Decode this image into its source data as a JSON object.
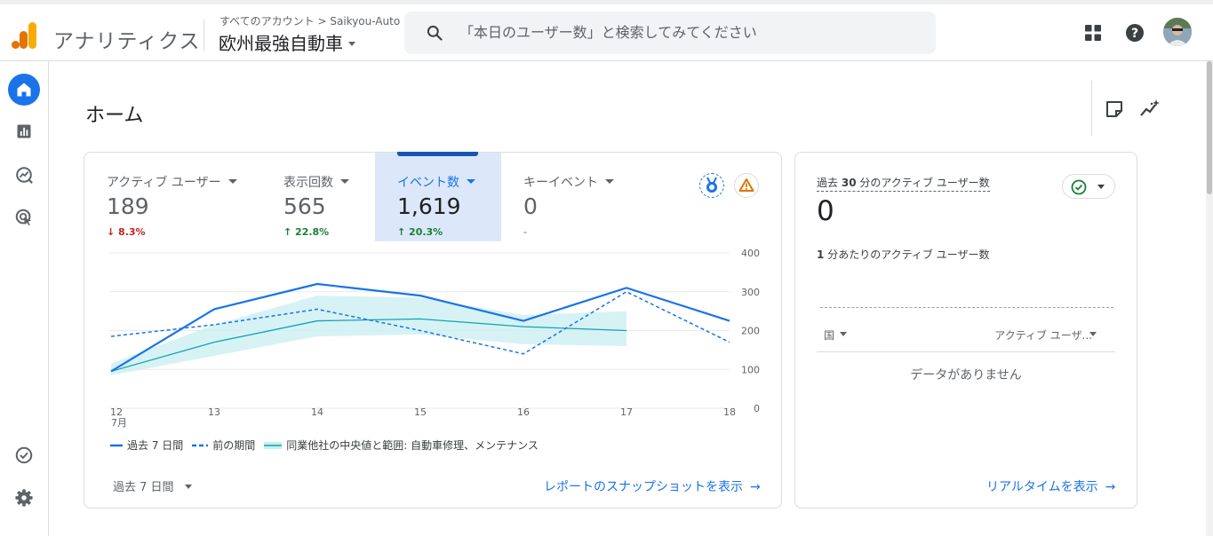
{
  "header": {
    "app_name": "アナリティクス",
    "breadcrumb": "すべてのアカウント > Saikyou-Auto",
    "property_name": "欧州最強自動車",
    "search_placeholder": "「本日のユーザー数」と検索してみてください",
    "icons": [
      "apps-grid-icon",
      "help-icon",
      "account-avatar"
    ]
  },
  "nav": {
    "items": [
      "home-icon",
      "reports-icon",
      "explore-icon",
      "advertising-icon"
    ],
    "bottom_items": [
      "configure-icon",
      "admin-gear-icon"
    ],
    "active": "home-icon"
  },
  "page": {
    "title": "ホーム",
    "header_icons": [
      "notes-icon",
      "insights-icon"
    ]
  },
  "metrics": [
    {
      "label": "アクティブ ユーザー",
      "value": "189",
      "delta": "↓ 8.3%",
      "trend": "down"
    },
    {
      "label": "表示回数",
      "value": "565",
      "delta": "↑ 22.8%",
      "trend": "up"
    },
    {
      "label": "イベント数",
      "value": "1,619",
      "delta": "↑ 20.3%",
      "trend": "up",
      "active": true
    },
    {
      "label": "キーイベント",
      "value": "0",
      "delta": "-",
      "trend": "flat"
    }
  ],
  "chart_data": {
    "type": "line",
    "categories": [
      "12",
      "13",
      "14",
      "15",
      "16",
      "17",
      "18"
    ],
    "x_sublabel": "7月",
    "ylim": [
      0,
      400
    ],
    "yticks": [
      "400",
      "300",
      "200",
      "100",
      "0"
    ],
    "grid": true,
    "series": [
      {
        "name": "過去 7 日間",
        "style": "solid",
        "color": "#1a73e8",
        "values": [
          95,
          255,
          320,
          290,
          225,
          310,
          225
        ]
      },
      {
        "name": "前の期間",
        "style": "dashed",
        "color": "#1a73e8",
        "values": [
          185,
          215,
          255,
          200,
          140,
          300,
          170
        ]
      },
      {
        "name": "同業他社の中央値と範囲: 自動車修理、メンテナンス",
        "style": "band",
        "color": "#12a4af",
        "values": [
          95,
          170,
          225,
          230,
          210,
          200
        ],
        "low": [
          85,
          135,
          185,
          190,
          165,
          160
        ],
        "high": [
          115,
          215,
          290,
          285,
          240,
          250
        ]
      }
    ],
    "legend_position": "bottom-left"
  },
  "card_footer": {
    "range_label": "過去 7 日間",
    "snapshot_link": "レポートのスナップショットを表示"
  },
  "realtime": {
    "title_prefix": "過去",
    "title_number": "30",
    "title_suffix": "分のアクティブ ユーザー数",
    "value": "0",
    "sub_number": "1",
    "sub_suffix": "分あたりのアクティブ ユーザー数",
    "col_country": "国",
    "col_active_users": "アクティブ ユーザ...",
    "empty_text": "データがありません",
    "link": "リアルタイムを表示"
  },
  "colors": {
    "accent": "#1a73e8",
    "active_tab_bg": "#dce8f9",
    "down": "#c5221f",
    "up": "#188038",
    "band": "#12a4af",
    "logo_orange": "#f9ab00",
    "logo_dark_orange": "#e37400",
    "alert": "#e37400"
  }
}
